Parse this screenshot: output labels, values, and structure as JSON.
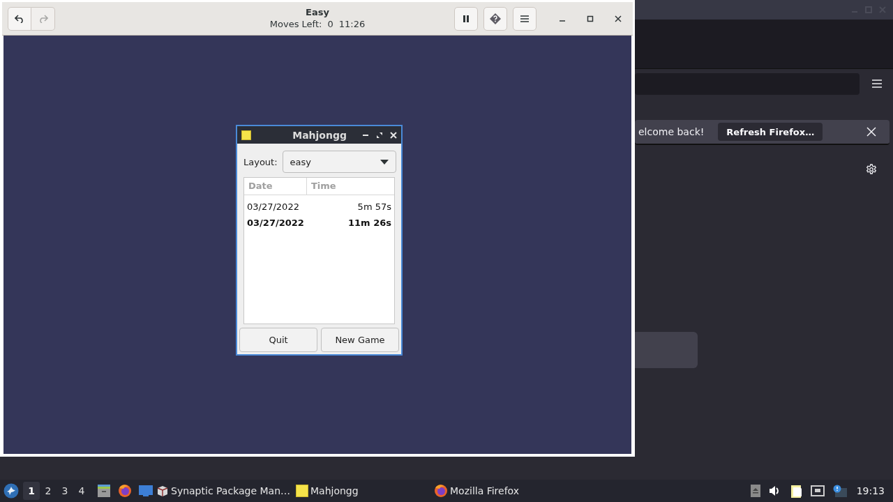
{
  "game_window": {
    "title": "Easy",
    "moves_label": "Moves Left:",
    "moves_left": "0",
    "time": "11:26",
    "undo": {
      "disabled": false
    },
    "redo": {
      "disabled": true
    }
  },
  "scores_dialog": {
    "title": "Mahjongg",
    "layout_label": "Layout:",
    "layout_value": "easy",
    "columns": [
      "Date",
      "Time"
    ],
    "rows": [
      {
        "date": "03/27/2022",
        "time": "5m 57s",
        "current": false
      },
      {
        "date": "03/27/2022",
        "time": "11m 26s",
        "current": true
      }
    ],
    "buttons": [
      "Quit",
      "New Game"
    ]
  },
  "browser_window": {
    "notification": {
      "message": "elcome back!",
      "button": "Refresh Firefox…"
    }
  },
  "taskbar": {
    "workspaces": [
      {
        "label": "1",
        "selected": true
      },
      {
        "label": "2",
        "selected": false
      },
      {
        "label": "3",
        "selected": false
      },
      {
        "label": "4",
        "selected": false
      }
    ],
    "tasks": [
      {
        "label": "Synaptic Package Man…",
        "kind": "package"
      },
      {
        "label": "Mahjongg",
        "kind": "mahjongg"
      },
      {
        "label": "Mozilla Firefox",
        "kind": "firefox"
      }
    ],
    "clock": "19:13"
  }
}
